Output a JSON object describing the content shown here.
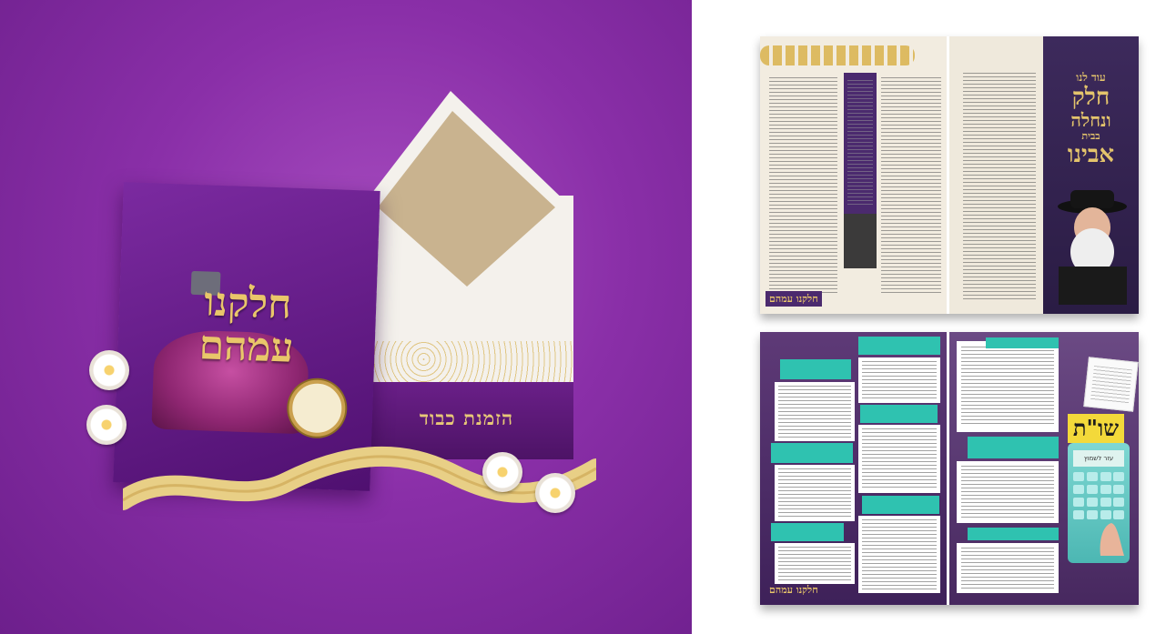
{
  "promo": {
    "card_title_line1": "חלקנו",
    "card_title_line2": "עמהם",
    "envelope_title": "הזמנת כבוד",
    "colors": {
      "background": "#8a2fa8",
      "gold": "#e9c66a",
      "envelope": "#f4f1ec"
    }
  },
  "spread1": {
    "title_line1": "עוד לנו",
    "title_line2": "חלק",
    "title_line3": "ונחלה",
    "title_line4": "בבית",
    "title_line5": "אבינו",
    "logo": "חלקנו עמהם"
  },
  "spread2": {
    "badge": "שו\"ת",
    "calculator_label": "עזר לשמוץ",
    "logo": "חלקנו עמהם"
  }
}
